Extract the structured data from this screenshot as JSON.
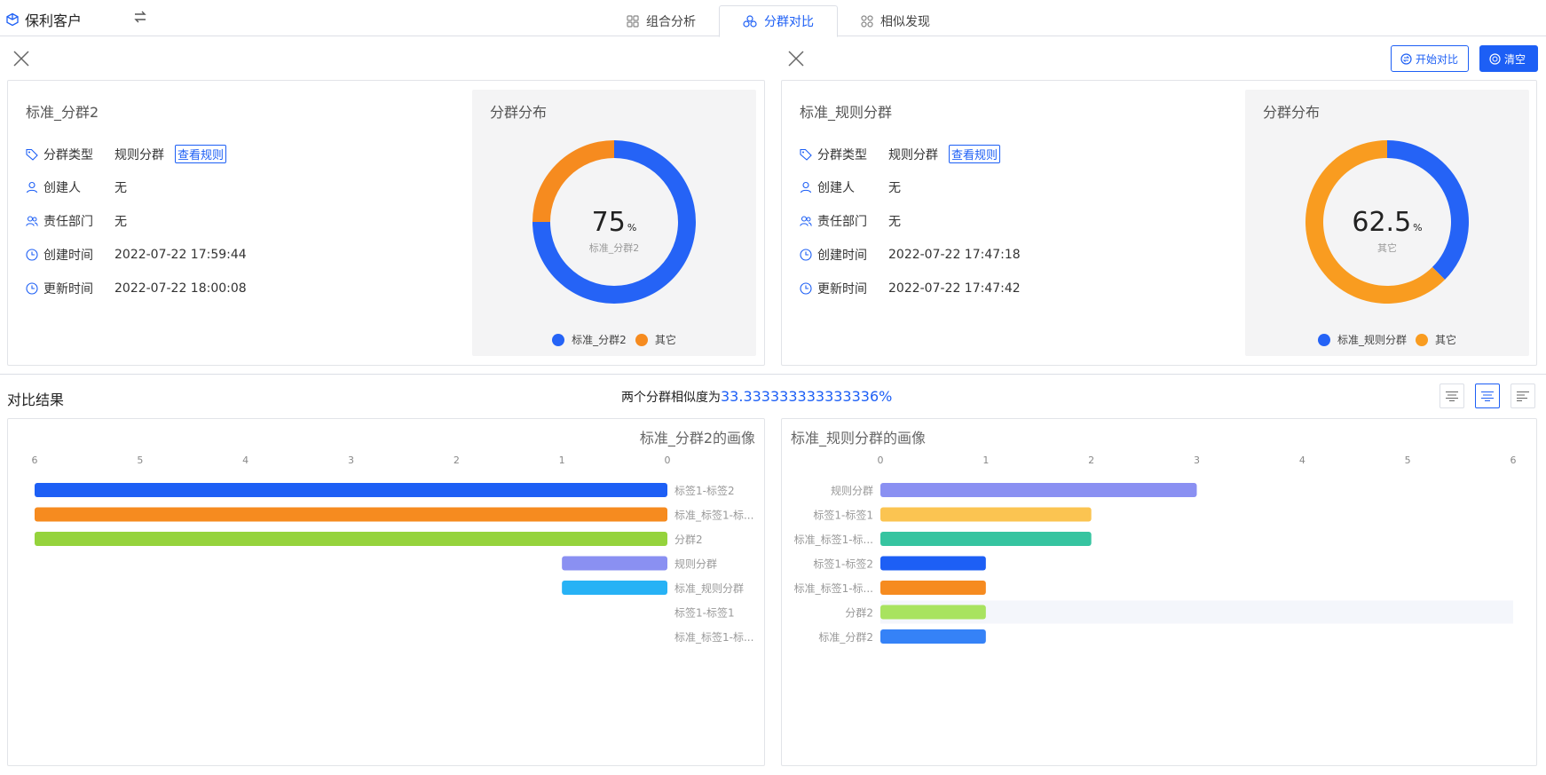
{
  "app": {
    "title": "保利客户"
  },
  "tabs": [
    {
      "label": "组合分析",
      "active": false
    },
    {
      "label": "分群对比",
      "active": true
    },
    {
      "label": "相似发现",
      "active": false
    }
  ],
  "actions": {
    "start_compare": "开始对比",
    "clear": "清空"
  },
  "info_labels": {
    "type": "分群类型",
    "creator": "创建人",
    "dept": "责任部门",
    "created": "创建时间",
    "updated": "更新时间",
    "view_rule": "查看规则"
  },
  "left": {
    "name": "标准_分群2",
    "type": "规则分群",
    "creator": "无",
    "dept": "无",
    "created": "2022-07-22 17:59:44",
    "updated": "2022-07-22 18:00:08",
    "dist_title": "分群分布",
    "center_value": "75",
    "center_unit": "%",
    "center_label": "标准_分群2",
    "legend": [
      "标准_分群2",
      "其它"
    ]
  },
  "right": {
    "name": "标准_规则分群",
    "type": "规则分群",
    "creator": "无",
    "dept": "无",
    "created": "2022-07-22 17:47:18",
    "updated": "2022-07-22 17:47:42",
    "dist_title": "分群分布",
    "center_value": "62.5",
    "center_unit": "%",
    "center_label": "其它",
    "legend": [
      "标准_规则分群",
      "其它"
    ]
  },
  "result": {
    "title": "对比结果",
    "similarity_prefix": "两个分群相似度为",
    "similarity_value": "33.333333333333336%"
  },
  "colors": {
    "accent": "#1d5ff5",
    "orange": "#f68b1f"
  },
  "chart_data": [
    {
      "type": "pie",
      "title": "分群分布",
      "labels": [
        "标准_分群2",
        "其它"
      ],
      "values": [
        75,
        25
      ],
      "colors": [
        "#2563f6",
        "#f68b1f"
      ]
    },
    {
      "type": "pie",
      "title": "分群分布",
      "labels": [
        "标准_规则分群",
        "其它"
      ],
      "values": [
        37.5,
        62.5
      ],
      "colors": [
        "#2563f6",
        "#f99c20"
      ]
    },
    {
      "type": "bar",
      "orientation": "horizontal-reversed",
      "title": "标准_分群2的画像",
      "categories": [
        "标签1-标签2",
        "标准_标签1-标...",
        "分群2",
        "规则分群",
        "标准_规则分群",
        "标签1-标签1",
        "标准_标签1-标..."
      ],
      "values": [
        6,
        6,
        6,
        1,
        1,
        0,
        0
      ],
      "colors": [
        "#1d5ff5",
        "#f68b1f",
        "#95d33c",
        "#8a90f2",
        "#27b2f5",
        "#cccccc",
        "#cccccc"
      ],
      "ticks": [
        "6",
        "5",
        "4",
        "3",
        "2",
        "1",
        "0"
      ],
      "xlim": [
        0,
        6
      ]
    },
    {
      "type": "bar",
      "orientation": "horizontal",
      "title": "标准_规则分群的画像",
      "categories": [
        "规则分群",
        "标签1-标签1",
        "标准_标签1-标...",
        "标签1-标签2",
        "标准_标签1-标...",
        "分群2",
        "标准_分群2"
      ],
      "values": [
        3,
        2,
        2,
        1,
        1,
        1,
        1
      ],
      "colors": [
        "#8a90f2",
        "#fbc451",
        "#36c4a0",
        "#1d5ff5",
        "#f68b1f",
        "#a8e35f",
        "#3582f7"
      ],
      "ticks": [
        "0",
        "1",
        "2",
        "3",
        "4",
        "5",
        "6"
      ],
      "xlim": [
        0,
        6
      ]
    }
  ]
}
